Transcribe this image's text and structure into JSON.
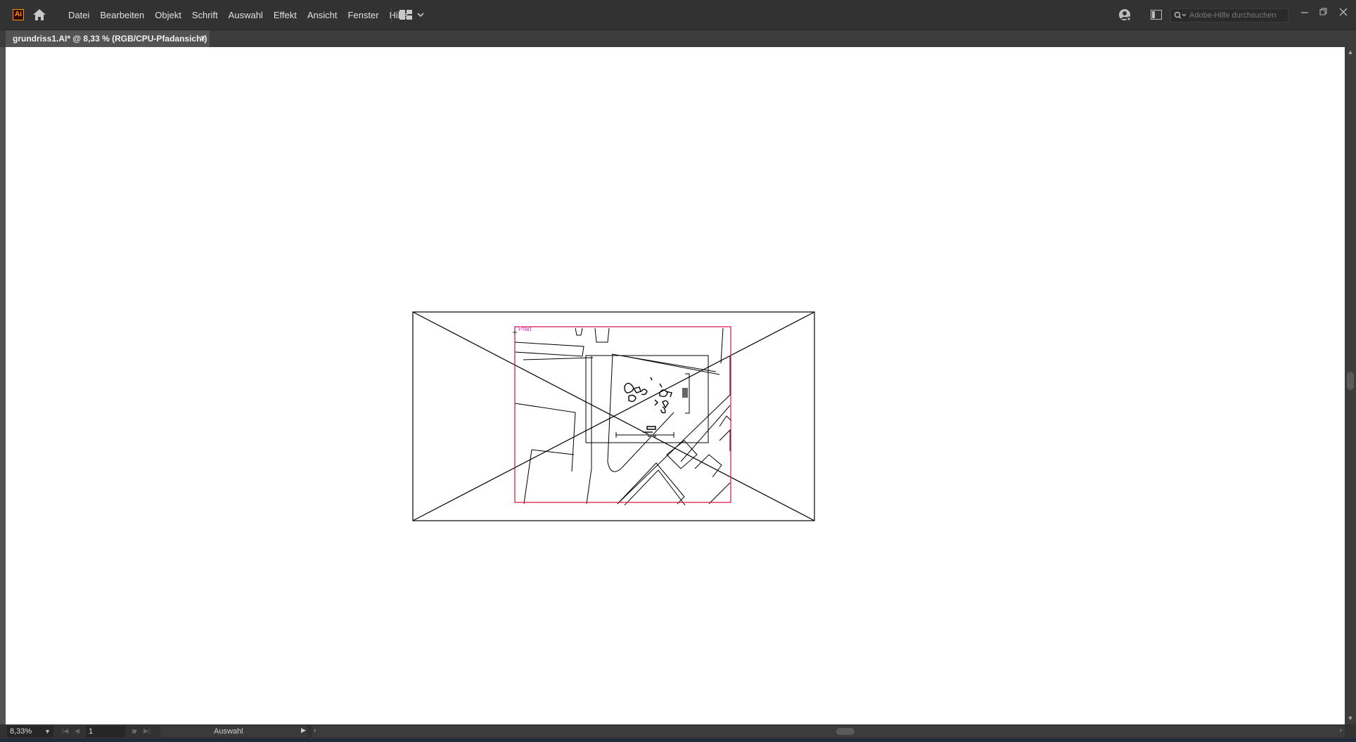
{
  "app": {
    "logo": "Ai"
  },
  "menu": [
    "Datei",
    "Bearbeiten",
    "Objekt",
    "Schrift",
    "Auswahl",
    "Effekt",
    "Ansicht",
    "Fenster",
    "Hilfe"
  ],
  "search": {
    "placeholder": "Adobe-Hilfe durchsuchen"
  },
  "document": {
    "tab_title": "grundriss1.AI* @ 8,33 % (RGB/CPU-Pfadansicht)",
    "close": "×"
  },
  "canvas": {
    "path_hint": "Pfad"
  },
  "status": {
    "zoom": "8,33%",
    "artboard": "1",
    "tool": "Auswahl"
  },
  "colors": {
    "menubar": "#323232",
    "canvas": "#ffffff",
    "artboard_outline": "#000000",
    "selection": "#d6214d",
    "smart_guide": "#e040c0",
    "accent_logo": "#ff9a00"
  },
  "icons": [
    "home-icon",
    "workspace-icon",
    "user-icon",
    "panel-icon",
    "search-icon",
    "minimize-icon",
    "restore-icon",
    "close-icon"
  ]
}
